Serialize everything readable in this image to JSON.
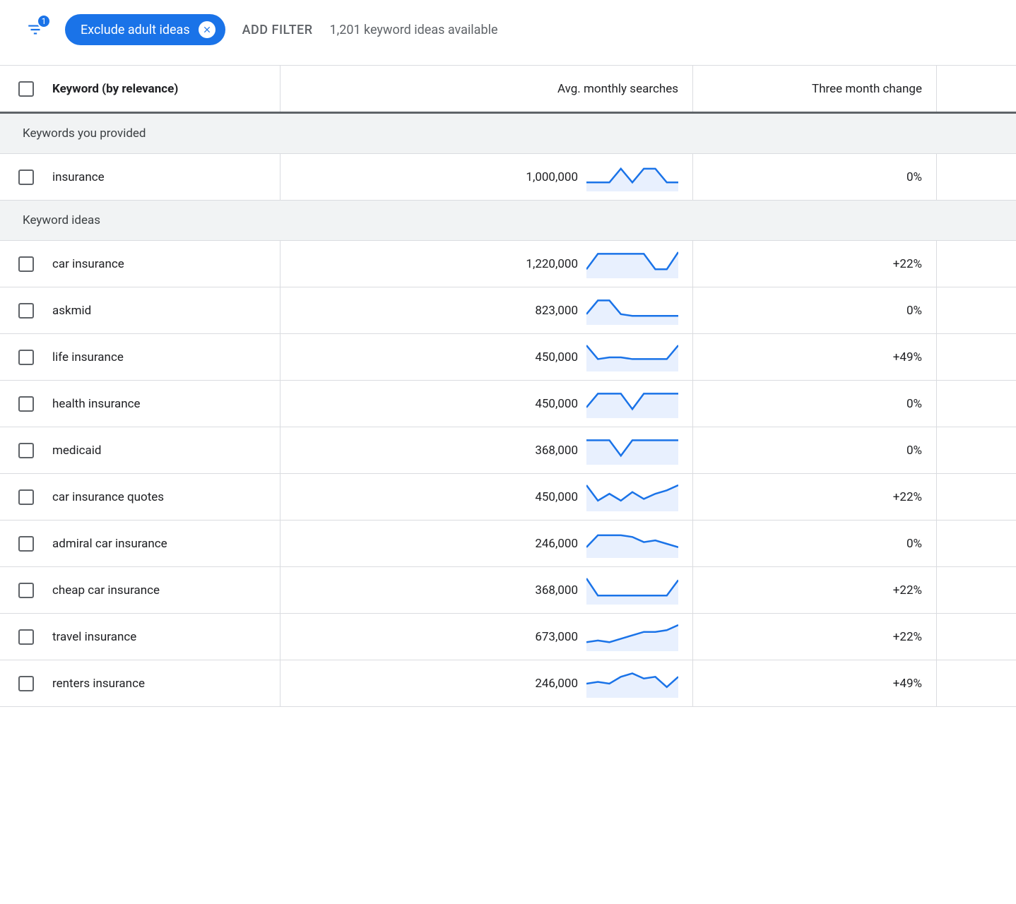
{
  "filter_bar": {
    "filter_badge_count": "1",
    "chip_label": "Exclude adult ideas",
    "add_filter_label": "ADD FILTER",
    "availability_text": "1,201 keyword ideas available"
  },
  "headers": {
    "keyword": "Keyword (by relevance)",
    "searches": "Avg. monthly searches",
    "change": "Three month change"
  },
  "sections": [
    {
      "title": "Keywords you provided",
      "rows": [
        {
          "keyword": "insurance",
          "searches": "1,000,000",
          "change": "0%",
          "spark": [
            4,
            4,
            4,
            12,
            4,
            12,
            12,
            4,
            4
          ]
        }
      ]
    },
    {
      "title": "Keyword ideas",
      "rows": [
        {
          "keyword": "car insurance",
          "searches": "1,220,000",
          "change": "+22%",
          "spark": [
            4,
            13,
            13,
            13,
            13,
            13,
            4,
            4,
            14
          ]
        },
        {
          "keyword": "askmid",
          "searches": "823,000",
          "change": "0%",
          "spark": [
            5,
            13,
            13,
            5,
            4,
            4,
            4,
            4,
            4
          ]
        },
        {
          "keyword": "life insurance",
          "searches": "450,000",
          "change": "+49%",
          "spark": [
            14,
            6,
            7,
            7,
            6,
            6,
            6,
            6,
            14
          ]
        },
        {
          "keyword": "health insurance",
          "searches": "450,000",
          "change": "0%",
          "spark": [
            5,
            13,
            13,
            13,
            4,
            13,
            13,
            13,
            13
          ]
        },
        {
          "keyword": "medicaid",
          "searches": "368,000",
          "change": "0%",
          "spark": [
            13,
            13,
            13,
            4,
            13,
            13,
            13,
            13,
            13
          ]
        },
        {
          "keyword": "car insurance quotes",
          "searches": "450,000",
          "change": "+22%",
          "spark": [
            14,
            5,
            9,
            5,
            10,
            6,
            9,
            11,
            14
          ]
        },
        {
          "keyword": "admiral car insurance",
          "searches": "246,000",
          "change": "0%",
          "spark": [
            5,
            12,
            12,
            12,
            11,
            8,
            9,
            7,
            5
          ]
        },
        {
          "keyword": "cheap car insurance",
          "searches": "368,000",
          "change": "+22%",
          "spark": [
            14,
            4,
            4,
            4,
            4,
            4,
            4,
            4,
            13
          ]
        },
        {
          "keyword": "travel insurance",
          "searches": "673,000",
          "change": "+22%",
          "spark": [
            4,
            5,
            4,
            6,
            8,
            10,
            10,
            11,
            14
          ]
        },
        {
          "keyword": "renters insurance",
          "searches": "246,000",
          "change": "+49%",
          "spark": [
            7,
            8,
            7,
            11,
            13,
            10,
            11,
            5,
            11
          ]
        }
      ]
    }
  ]
}
